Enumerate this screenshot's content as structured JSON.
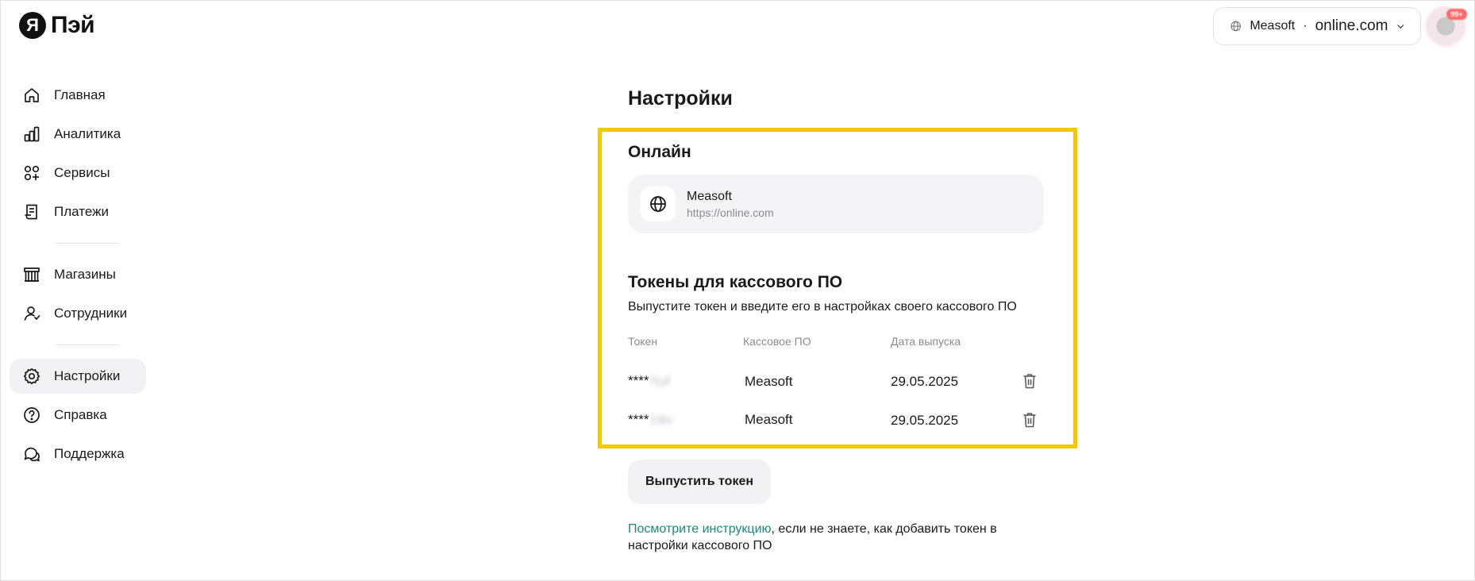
{
  "logo": {
    "mark": "Я",
    "text": "Пэй"
  },
  "header": {
    "shop_name": "Measoft",
    "separator": "·",
    "shop_domain": "online.com",
    "avatar_badge": "99+"
  },
  "sidebar": {
    "items": [
      {
        "label": "Главная",
        "icon": "home-icon"
      },
      {
        "label": "Аналитика",
        "icon": "bar-chart-icon"
      },
      {
        "label": "Сервисы",
        "icon": "services-icon"
      },
      {
        "label": "Платежи",
        "icon": "receipt-icon"
      },
      {
        "label": "Магазины",
        "icon": "store-icon"
      },
      {
        "label": "Сотрудники",
        "icon": "people-icon"
      },
      {
        "label": "Настройки",
        "icon": "gear-icon",
        "active": true
      },
      {
        "label": "Справка",
        "icon": "help-icon"
      },
      {
        "label": "Поддержка",
        "icon": "chat-icon"
      }
    ]
  },
  "main": {
    "title": "Настройки",
    "online": {
      "title": "Онлайн",
      "site_name": "Measoft",
      "site_url": "https://online.com"
    },
    "tokens": {
      "title": "Токены для кассового ПО",
      "subtitle": "Выпустите токен и введите его в настройках своего кассового ПО",
      "columns": [
        "Токен",
        "Кассовое ПО",
        "Дата выпуска"
      ],
      "rows": [
        {
          "token_mask": "****",
          "token_hidden": "f1yf",
          "software": "Measoft",
          "date": "29.05.2025"
        },
        {
          "token_mask": "****",
          "token_hidden": "z3tv",
          "software": "Measoft",
          "date": "29.05.2025"
        }
      ],
      "issue_button": "Выпустить токен"
    },
    "help": {
      "link_text": "Посмотрите инструкцию",
      "rest_text": ", если не знаете, как добавить токен в настройки кассового ПО"
    }
  },
  "colors": {
    "highlight": "#f5c800",
    "link": "#1a8a7a",
    "muted": "#8a8a96",
    "active_bg": "#f2f2f4"
  }
}
